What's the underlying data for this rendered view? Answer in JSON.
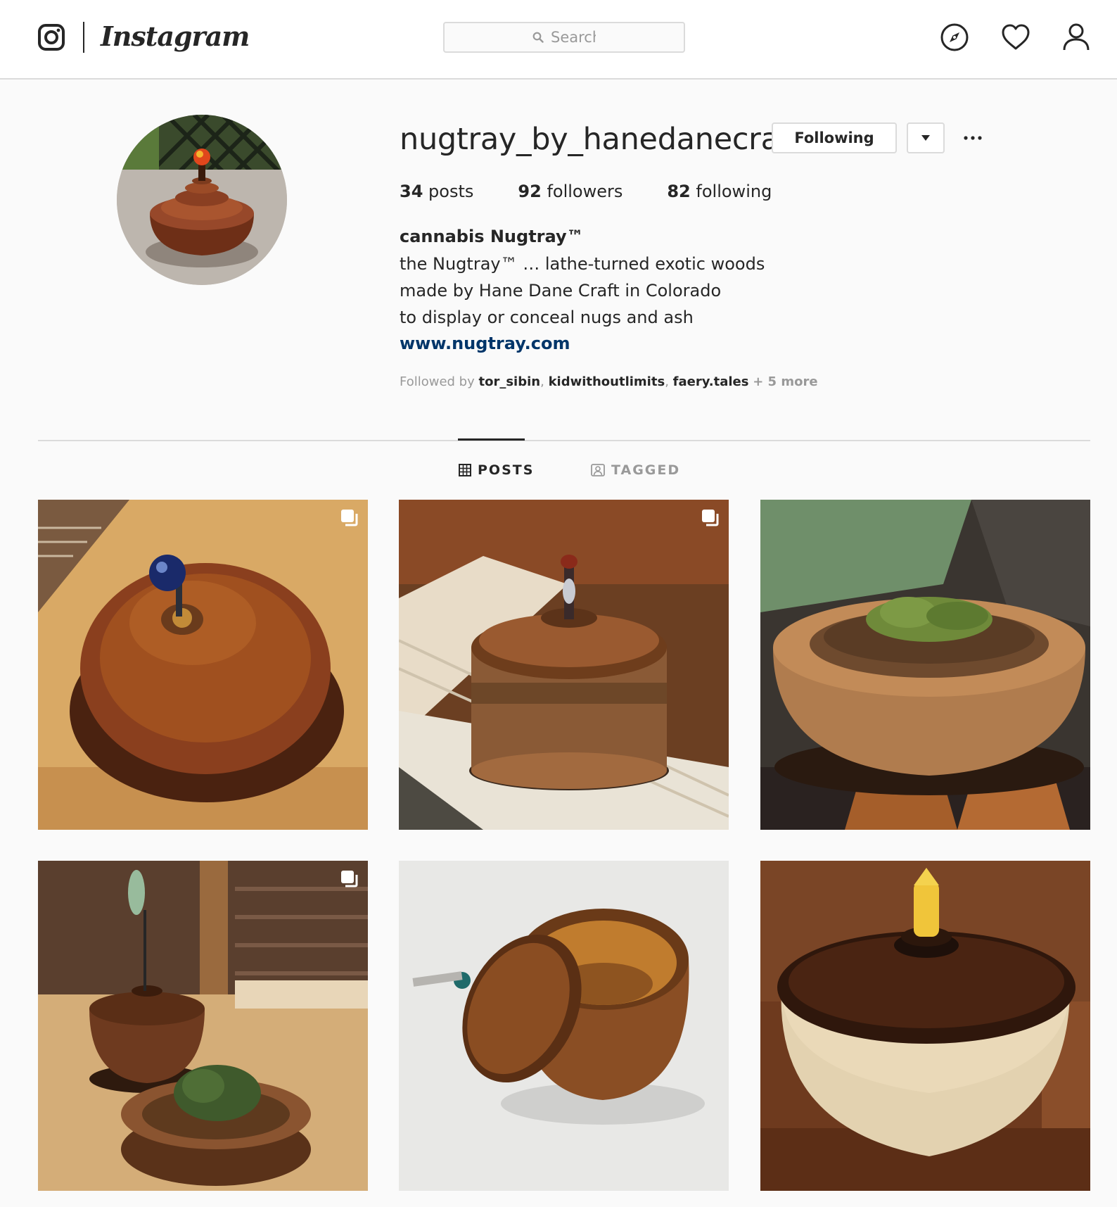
{
  "header": {
    "wordmark": "Instagram",
    "search_placeholder": "Search",
    "icons": [
      "instagram-camera-icon",
      "search-icon",
      "compass-icon",
      "heart-icon",
      "profile-icon"
    ]
  },
  "profile": {
    "username": "nugtray_by_hanedanecraft",
    "follow_button": "Following",
    "posts_count": "34",
    "posts_label": "posts",
    "followers_count": "92",
    "followers_label": "followers",
    "following_count": "82",
    "following_label": "following",
    "full_name": "cannabis Nugtray™",
    "bio_lines": [
      "the Nugtray™ … lathe-turned exotic woods",
      "made by Hane Dane Craft in Colorado",
      "to display or conceal nugs and ash"
    ],
    "website": "www.nugtray.com",
    "followed_by_label": "Followed by",
    "followed_by_users": [
      "tor_sibin",
      "kidwithoutlimits",
      "faery.tales"
    ],
    "followed_by_more": "+ 5 more"
  },
  "tabs": [
    {
      "label": "POSTS",
      "active": true
    },
    {
      "label": "TAGGED",
      "active": false
    }
  ],
  "posts": [
    {
      "subject": "walnut nug jar with blue glass knob",
      "multiple": true
    },
    {
      "subject": "walnut nug jar on striped rug",
      "multiple": true
    },
    {
      "subject": "wood bowl with nugs",
      "multiple": false
    },
    {
      "subject": "nug jar with glass stem and nug dish",
      "multiple": true
    },
    {
      "subject": "open wood jar with lid",
      "multiple": false
    },
    {
      "subject": "two-tone jar with yellow knob",
      "multiple": false
    }
  ],
  "colors": {
    "background": "#fafafa",
    "border": "#dbdbdb",
    "text": "#262626",
    "muted": "#999999",
    "link": "#003569"
  }
}
